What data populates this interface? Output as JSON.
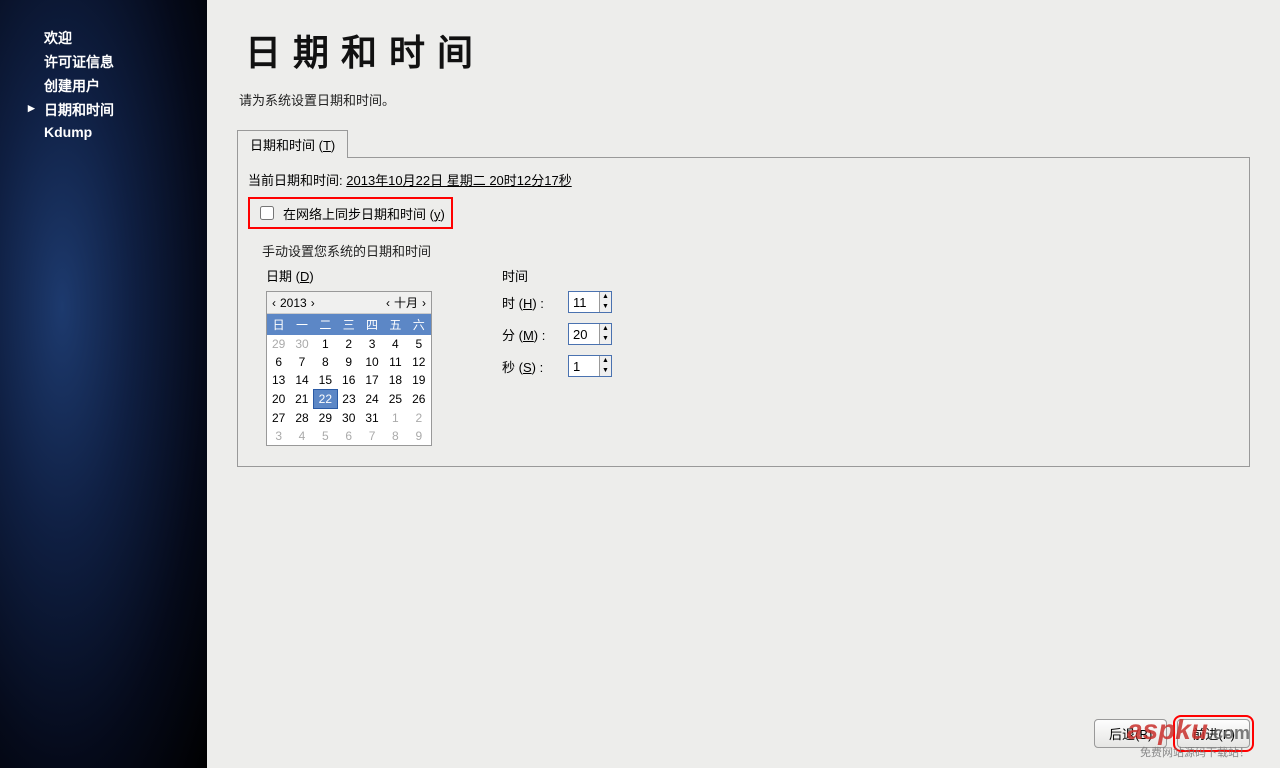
{
  "sidebar": {
    "items": [
      {
        "label": "欢迎"
      },
      {
        "label": "许可证信息"
      },
      {
        "label": "创建用户"
      },
      {
        "label": "日期和时间",
        "active": true
      },
      {
        "label": "Kdump"
      }
    ]
  },
  "header": {
    "title": "日期和时间",
    "prompt": "请为系统设置日期和时间。"
  },
  "tab": {
    "label_prefix": "日期和时间 (",
    "mnemonic": "T",
    "label_suffix": ")"
  },
  "current": {
    "prefix": "当前日期和时间:",
    "value": "2013年10月22日 星期二  20时12分17秒"
  },
  "sync": {
    "label_prefix": "在网络上同步日期和时间 (",
    "mnemonic": "y",
    "label_suffix": ")",
    "checked": false
  },
  "manual_label": "手动设置您系统的日期和时间",
  "date": {
    "section_prefix": "日期 (",
    "section_mnemonic": "D",
    "section_suffix": ")",
    "year": "2013",
    "month": "十月",
    "dow": [
      "日",
      "一",
      "二",
      "三",
      "四",
      "五",
      "六"
    ],
    "weeks": [
      [
        {
          "d": "29",
          "dim": true
        },
        {
          "d": "30",
          "dim": true
        },
        {
          "d": "1"
        },
        {
          "d": "2"
        },
        {
          "d": "3"
        },
        {
          "d": "4"
        },
        {
          "d": "5"
        }
      ],
      [
        {
          "d": "6"
        },
        {
          "d": "7"
        },
        {
          "d": "8"
        },
        {
          "d": "9"
        },
        {
          "d": "10"
        },
        {
          "d": "11"
        },
        {
          "d": "12"
        }
      ],
      [
        {
          "d": "13"
        },
        {
          "d": "14"
        },
        {
          "d": "15"
        },
        {
          "d": "16"
        },
        {
          "d": "17"
        },
        {
          "d": "18"
        },
        {
          "d": "19"
        }
      ],
      [
        {
          "d": "20"
        },
        {
          "d": "21"
        },
        {
          "d": "22",
          "sel": true
        },
        {
          "d": "23"
        },
        {
          "d": "24"
        },
        {
          "d": "25"
        },
        {
          "d": "26"
        }
      ],
      [
        {
          "d": "27"
        },
        {
          "d": "28"
        },
        {
          "d": "29"
        },
        {
          "d": "30"
        },
        {
          "d": "31"
        },
        {
          "d": "1",
          "dim": true
        },
        {
          "d": "2",
          "dim": true
        }
      ],
      [
        {
          "d": "3",
          "dim": true
        },
        {
          "d": "4",
          "dim": true
        },
        {
          "d": "5",
          "dim": true
        },
        {
          "d": "6",
          "dim": true
        },
        {
          "d": "7",
          "dim": true
        },
        {
          "d": "8",
          "dim": true
        },
        {
          "d": "9",
          "dim": true
        }
      ]
    ]
  },
  "time": {
    "section": "时间",
    "hour": {
      "prefix": "时 (",
      "mnemonic": "H",
      "suffix": ") :",
      "value": "11"
    },
    "minute": {
      "prefix": "分 (",
      "mnemonic": "M",
      "suffix": ") :",
      "value": "20"
    },
    "second": {
      "prefix": "秒 (",
      "mnemonic": "S",
      "suffix": ") :",
      "value": "1"
    }
  },
  "footer": {
    "back": "后退(B)",
    "forward": "前进(F)"
  },
  "watermark": {
    "brand": "aspku",
    "brand_suffix": ".com",
    "sub": "免费网站源码下载站！"
  }
}
